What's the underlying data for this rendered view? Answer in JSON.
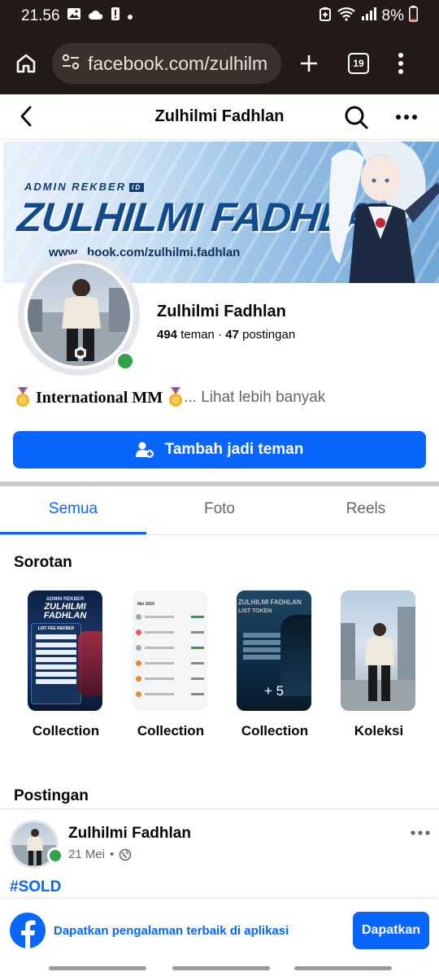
{
  "status_bar": {
    "time": "21.56",
    "battery": "8%"
  },
  "browser": {
    "url": "facebook.com/zulhilm",
    "tab_count": "19"
  },
  "header": {
    "title": "Zulhilmi Fadhlan"
  },
  "cover": {
    "admin_text": "ADMIN REKBER",
    "admin_tag": "ID",
    "big_name": "ZULHILMI FADHLAN",
    "url_text": "www.  .book.com/zulhilmi.fadhlan"
  },
  "profile": {
    "name": "Zulhilmi Fadhlan",
    "friends_count": "494",
    "friends_label": "teman",
    "separator": "·",
    "posts_count": "47",
    "posts_label": "postingan",
    "bio": "International MM",
    "see_more": "... Lihat lebih banyak"
  },
  "actions": {
    "add_friend": "Tambah jadi teman"
  },
  "tabs": [
    {
      "label": "Semua",
      "active": true
    },
    {
      "label": "Foto",
      "active": false
    },
    {
      "label": "Reels",
      "active": false
    }
  ],
  "highlights": {
    "title": "Sorotan",
    "items": [
      {
        "label": "Collection",
        "thumb_title": "ADMIN REKBER",
        "thumb_name": "ZULHILMI FADHLAN",
        "thumb_sub": "LIST FEE REKBER"
      },
      {
        "label": "Collection",
        "thumb_title": "Mei 2025"
      },
      {
        "label": "Collection",
        "thumb_title": "ZULHILMI FADHLAN",
        "thumb_sub": "LIST TOKEN",
        "overlay": "+ 5"
      },
      {
        "label": "Koleksi"
      }
    ]
  },
  "posts": {
    "title": "Postingan",
    "items": [
      {
        "author": "Zulhilmi Fadhlan",
        "date": "21 Mei",
        "dot": "•",
        "text": "#SOLD"
      }
    ]
  },
  "app_banner": {
    "text": "Dapatkan pengalaman terbaik di aplikasi",
    "button": "Dapatkan"
  },
  "colors": {
    "brand": "#0866ff",
    "online": "#31a24c",
    "status_bg": "#231b17"
  }
}
